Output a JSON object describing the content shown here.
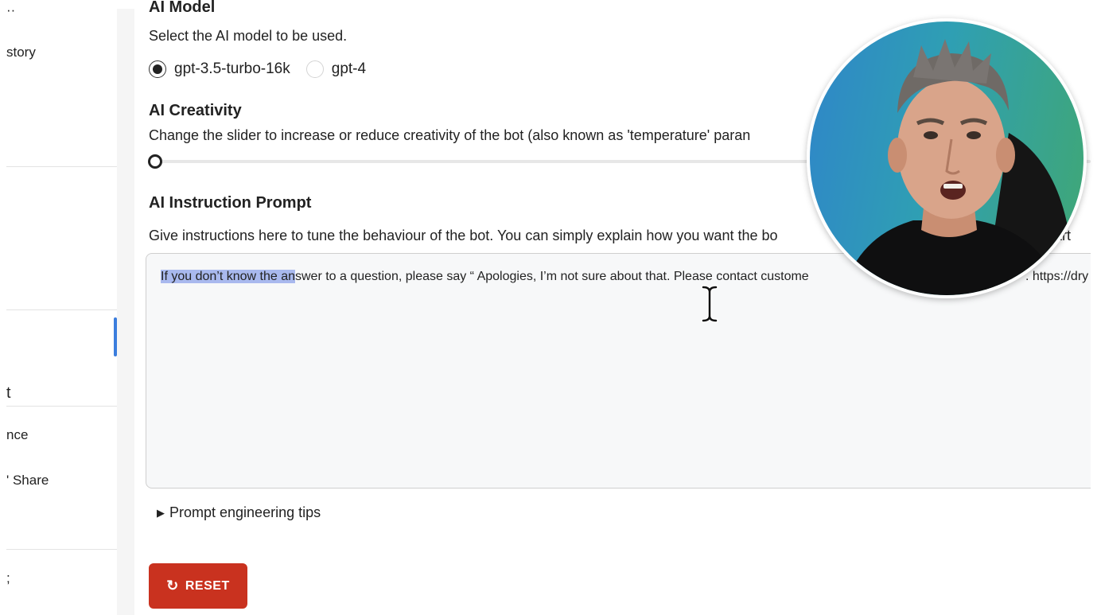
{
  "sidebar": {
    "items": [
      {
        "label": "··"
      },
      {
        "label": "story"
      },
      {
        "label": "t"
      },
      {
        "label": "nce"
      },
      {
        "label": "' Share"
      },
      {
        "label": ";"
      }
    ]
  },
  "ai_model": {
    "title": "AI Model",
    "description": "Select the AI model to be used.",
    "options": [
      {
        "label": "gpt-3.5-turbo-16k",
        "checked": true
      },
      {
        "label": "gpt-4",
        "checked": false
      }
    ]
  },
  "ai_creativity": {
    "title": "AI Creativity",
    "description": "Change the slider to increase or reduce creativity of the bot (also known as 'temperature' paran",
    "slider_value": 0
  },
  "ai_instruction": {
    "title": "AI Instruction Prompt",
    "description": "Give instructions here to tune the behaviour of the bot. You can simply explain how you want the bo",
    "description_tail": "part",
    "prompt_selected": "If you don’t know the an",
    "prompt_rest": "swer to a question, please say “ Apologies, I’m not sure about that. Please contact custome",
    "prompt_tail": ". https://dry"
  },
  "tips": {
    "label": "Prompt engineering tips"
  },
  "reset_button": {
    "label": "RESET",
    "color": "#c9321f"
  },
  "colors": {
    "accent": "#3b7ddd",
    "selection": "#a9b9ee"
  }
}
